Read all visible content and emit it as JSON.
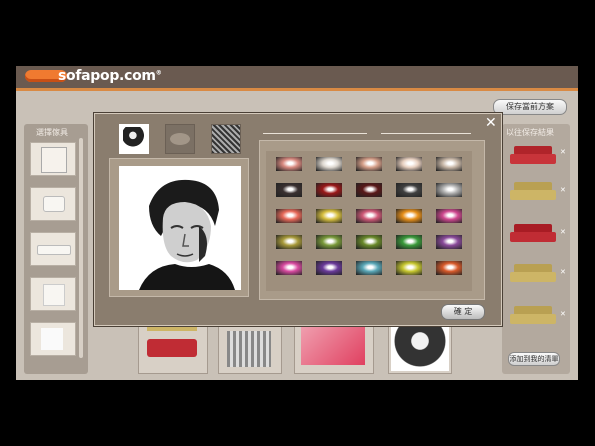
{
  "header": {
    "brand": "sofapop.com",
    "brand_mark": "®",
    "save_button_label": "保存當前方案"
  },
  "left_panel": {
    "title": "選擇傢具"
  },
  "right_panel": {
    "title": "以往保存結果",
    "add_button_label": "添加到我的清單"
  },
  "dialog": {
    "close_label": "✕",
    "ok_label": "確 定",
    "tabs": [
      "portrait-tab",
      "lips-tab",
      "texture-tab"
    ]
  },
  "palette_colors": [
    [
      "#d98a80",
      "#ded8d0",
      "#d7a08a",
      "#e8d0c0",
      "#c9b8a8"
    ],
    [
      "#3a3030",
      "#9a1818",
      "#5a1818",
      "#404040",
      "#b0b0b0"
    ],
    [
      "#e86a5a",
      "#d8c040",
      "#d05a78",
      "#e8901a",
      "#d04890"
    ],
    [
      "#a89a3a",
      "#7a9a3a",
      "#6a8a2a",
      "#3a9a3a",
      "#8a4a9a"
    ],
    [
      "#d84aa0",
      "#6a3a9a",
      "#5aa8b8",
      "#c8c830",
      "#d85a2a"
    ]
  ]
}
